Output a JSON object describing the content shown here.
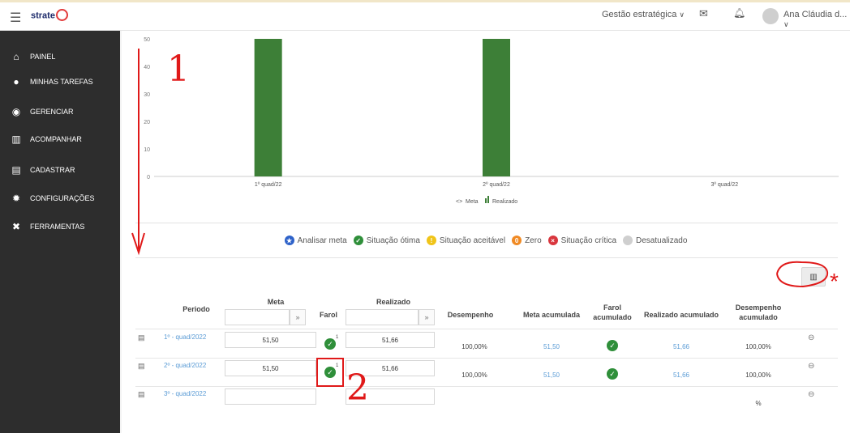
{
  "topbar": {
    "logo_text": "strate",
    "module_label": "Gestão estratégica",
    "module_chevron": "⌄",
    "mail_icon": "✉",
    "bell_icon": "♫",
    "user_name": "Ana Cláudia d..."
  },
  "sidebar": {
    "items": [
      {
        "label": "PAINEL",
        "icon": "home-icon"
      },
      {
        "label": "MINHAS TAREFAS",
        "icon": "users-icon"
      },
      {
        "label": "GERENCIAR",
        "icon": "dashboard-icon"
      },
      {
        "label": "ACOMPANHAR",
        "icon": "chart-icon"
      },
      {
        "label": "CADASTRAR",
        "icon": "file-icon"
      },
      {
        "label": "CONFIGURAÇÕES",
        "icon": "gear-icon"
      },
      {
        "label": "FERRAMENTAS",
        "icon": "tools-icon"
      }
    ]
  },
  "chart_data": {
    "type": "bar",
    "categories": [
      "1º quad/22",
      "2º quad/22",
      "3º quad/22"
    ],
    "series": [
      {
        "name": "Meta",
        "values": [
          null,
          null,
          null
        ]
      },
      {
        "name": "Realizado",
        "values": [
          51.66,
          51.66,
          null
        ]
      }
    ],
    "y_ticks": [
      "0",
      "10",
      "20",
      "30",
      "40",
      "50"
    ],
    "ylim": [
      0,
      50
    ],
    "bar_color": "#3d7f37",
    "legend": [
      "Meta",
      "Realizado"
    ]
  },
  "status_legend": [
    {
      "label": "Analisar meta",
      "color": "#2e62c9",
      "symbol": "★"
    },
    {
      "label": "Situação ótima",
      "color": "#2f8f3a",
      "symbol": "✓"
    },
    {
      "label": "Situação aceitável",
      "color": "#f0c419",
      "symbol": "!"
    },
    {
      "label": "Zero",
      "color": "#f08a24",
      "symbol": "0"
    },
    {
      "label": "Situação crítica",
      "color": "#d9363e",
      "symbol": "×"
    },
    {
      "label": "Desatualizado",
      "color": "#cfcfcf",
      "symbol": ""
    }
  ],
  "table": {
    "headers": {
      "periodo": "Periodo",
      "meta": "Meta",
      "farol": "Farol",
      "realizado": "Realizado",
      "desempenho": "Desempenho",
      "meta_acumulada": "Meta acumulada",
      "farol_acumulado": "Farol acumulado",
      "realizado_acumulado": "Realizado acumulado",
      "desempenho_acumulado": "Desempenho acumulado"
    },
    "filter_icon": "»",
    "rows": [
      {
        "periodo": "1º - quad/2022",
        "meta": "51,50",
        "realizado": "51,66",
        "farol_sup": "1",
        "desempenho": "100,00%",
        "meta_acum": "51,50",
        "realizado_acum": "51,66",
        "desempenho_acum": "100,00%",
        "has_farol": true
      },
      {
        "periodo": "2º - quad/2022",
        "meta": "51,50",
        "realizado": "51,66",
        "farol_sup": "1",
        "desempenho": "100,00%",
        "meta_acum": "51,50",
        "realizado_acum": "51,66",
        "desempenho_acum": "100,00%",
        "has_farol": true
      },
      {
        "periodo": "3º - quad/2022",
        "meta": "",
        "realizado": "",
        "farol_sup": "",
        "desempenho": "",
        "meta_acum": "",
        "realizado_acum": "",
        "desempenho_acum": "%",
        "has_farol": false
      }
    ]
  },
  "annotations": {
    "label_1": "1",
    "label_2": "2",
    "label_star": "*"
  },
  "colors": {
    "sidebar_bg": "#2d2d2d",
    "accent_link": "#5a9bd5",
    "annotation_red": "#e01919"
  }
}
